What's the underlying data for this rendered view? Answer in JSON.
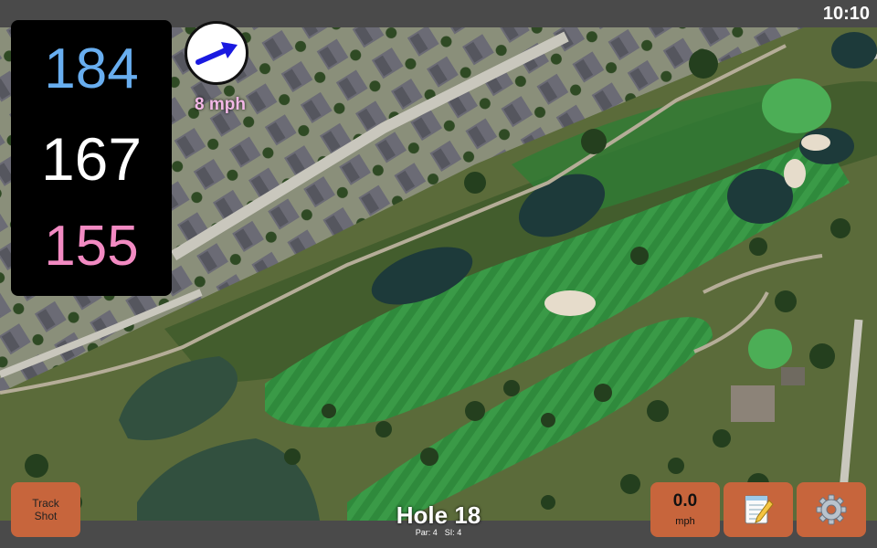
{
  "status": {
    "time": "10:10"
  },
  "distances": {
    "back": "184",
    "middle": "167",
    "front": "155"
  },
  "wind": {
    "speed_label": "8 mph",
    "direction_icon": "arrow-east-northeast"
  },
  "hole": {
    "title": "Hole 18",
    "par_label": "Par: 4",
    "si_label": "SI: 4"
  },
  "buttons": {
    "track_shot_label": "Track Shot",
    "speed_value": "0.0",
    "speed_unit": "mph",
    "notes_icon": "notepad-icon",
    "settings_icon": "gear-icon"
  },
  "colors": {
    "back_distance": "#68aef0",
    "middle_distance": "#ffffff",
    "front_distance": "#f28ac2",
    "button": "#c7653c",
    "wind_label": "#f3b8e6"
  }
}
